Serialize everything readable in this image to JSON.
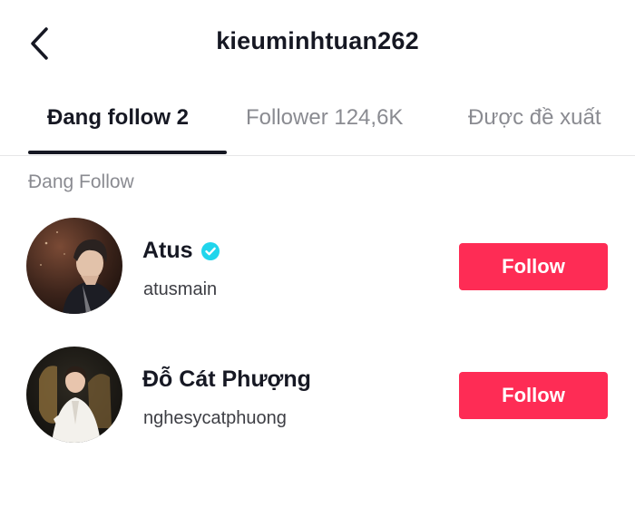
{
  "header": {
    "title": "kieuminhtuan262",
    "back_icon": "chevron-left-icon"
  },
  "tabs": [
    {
      "label": "Đang follow 2",
      "active": true
    },
    {
      "label": "Follower 124,6K",
      "active": false
    },
    {
      "label": "Được đề xuất",
      "active": false
    }
  ],
  "section": {
    "label": "Đang Follow"
  },
  "users": [
    {
      "name": "Atus",
      "verified": true,
      "handle": "atusmain",
      "button_label": "Follow"
    },
    {
      "name": "Đỗ Cát Phượng",
      "verified": false,
      "handle": "nghesycatphuong",
      "button_label": "Follow"
    }
  ],
  "colors": {
    "accent": "#fe2c55",
    "verified_badge": "#20d5ec",
    "text_primary": "#161823",
    "text_secondary": "#8a8b91"
  }
}
